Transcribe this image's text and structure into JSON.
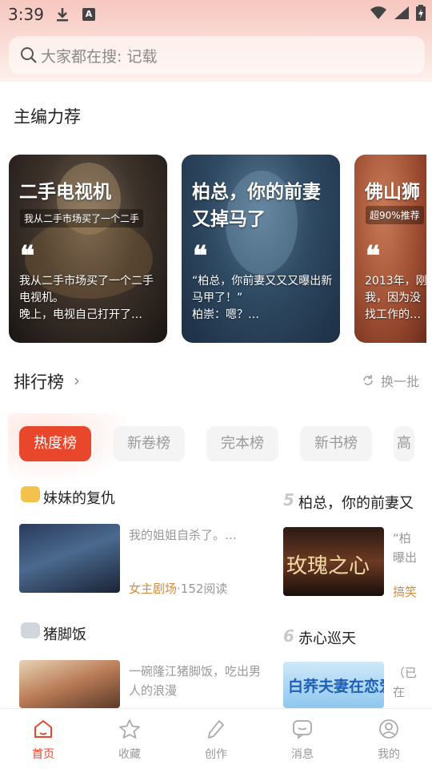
{
  "status_bar": {
    "time": "3:39",
    "a_icon": "A"
  },
  "search": {
    "placeholder": "大家都在搜: 记载"
  },
  "editor_picks": {
    "title": "主编力荐",
    "cards": [
      {
        "title": "二手电视机",
        "tag": "我从二手市场买了一个二手",
        "desc": "我从二手市场买了一个二手电视机。\n晚上，电视自己打开了…",
        "accent": "#3e332b"
      },
      {
        "title": "柏总，你的前妻又掉马了",
        "tag": "",
        "desc": "“柏总，你前妻又又又曝出新马甲了！”\n柏崇：嗯？…",
        "accent": "#2f4a63"
      },
      {
        "title": "佛山狮",
        "tag": "超90%推荐",
        "desc": "2013年，刚我，因为没找工作的…",
        "accent": "#9b4b30"
      }
    ]
  },
  "ranking": {
    "title": "排行榜",
    "refresh_label": "换一批",
    "tabs": [
      "热度榜",
      "新卷榜",
      "完本榜",
      "新书榜",
      "高"
    ],
    "active_tab": 0,
    "items": [
      {
        "rank": "1",
        "name": "妹妹的复仇",
        "blurb": "我的姐姐自杀了。…",
        "category": "女主剧场",
        "reads": "·152阅读"
      },
      {
        "rank": "5",
        "name": "柏总，你的前妻又",
        "blurb": "“柏曝出",
        "category": "搞笑",
        "reads": ""
      },
      {
        "rank": "2",
        "name": "猪脚饭",
        "blurb": "一碗隆江猪脚饭，吃出男人的浪漫",
        "category": "",
        "reads": ""
      },
      {
        "rank": "6",
        "name": "赤心巡天",
        "blurb": "（已在",
        "category": "",
        "reads": ""
      }
    ],
    "cover_texts": [
      "玫瑰之心",
      "白荞夫妻在恋爱"
    ]
  },
  "bottom_nav": {
    "items": [
      {
        "label": "首页",
        "icon": "home-icon"
      },
      {
        "label": "收藏",
        "icon": "star-icon"
      },
      {
        "label": "创作",
        "icon": "pen-icon"
      },
      {
        "label": "消息",
        "icon": "message-icon"
      },
      {
        "label": "我的",
        "icon": "user-icon"
      }
    ],
    "active_index": 0,
    "active_color": "#e8472c"
  }
}
